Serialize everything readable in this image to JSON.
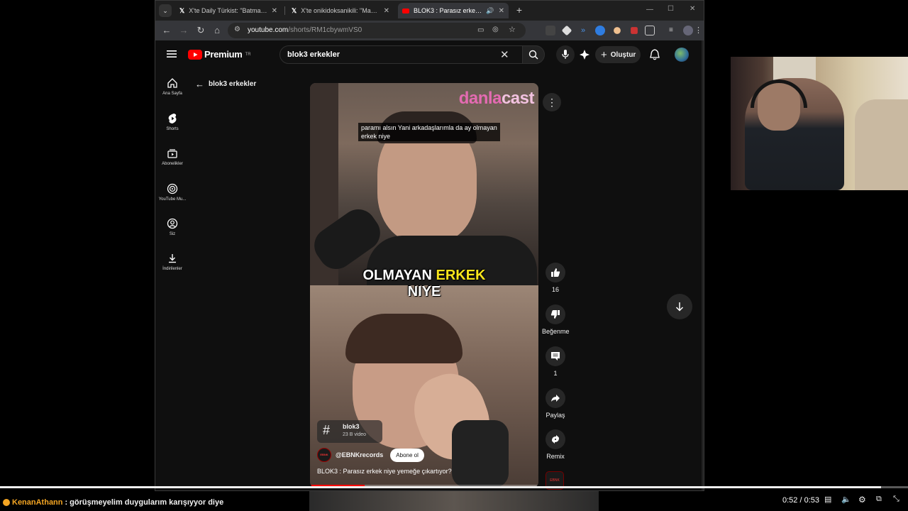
{
  "browser": {
    "tabs": [
      {
        "title": "X'te Daily Türkist: \"Batman'da y...",
        "icon": "x-logo-icon"
      },
      {
        "title": "X'te onikidoksanikili: \"Manifest...",
        "icon": "x-logo-icon"
      },
      {
        "title": "BLOK3 : Parasız erkek niye y...",
        "icon": "youtube-icon",
        "active": true
      }
    ],
    "url_host": "youtube.com",
    "url_path": "/shorts/RM1cbywmVS0"
  },
  "youtube": {
    "logo_text": "Premium",
    "logo_region": "TR",
    "search_value": "blok3 erkekler",
    "create_label": "Oluştur",
    "sidebar": [
      {
        "label": "Ana Sayfa",
        "icon": "home-icon"
      },
      {
        "label": "Shorts",
        "icon": "shorts-icon"
      },
      {
        "label": "Abonelikler",
        "icon": "subscriptions-icon"
      },
      {
        "label": "YouTube Mu...",
        "icon": "youtube-music-icon"
      },
      {
        "label": "Siz",
        "icon": "you-icon"
      },
      {
        "label": "İndirilenler",
        "icon": "downloads-icon"
      }
    ],
    "back_label": "blok3 erkekler",
    "video": {
      "brand_a": "danla",
      "brand_b": "cast",
      "caption": "paramı alsın Yani arkadaşlarımla da ay olmayan erkek niye",
      "big_caption_1": "OLMAYAN",
      "big_caption_2": "ERKEK",
      "big_caption_3": "NIYE",
      "hashtag": "blok3",
      "hashtag_count": "23 B video",
      "channel": "@EBNKrecords",
      "channel_avatar_text": "EBNK",
      "subscribe_label": "Abone ol",
      "title": "BLOK3 : Parasız erkek niye yemeğe çıkartıyor?",
      "progress": 0.24
    },
    "actions": {
      "like_count": "16",
      "dislike_label": "Beğenme",
      "comment_count": "1",
      "share_label": "Paylaş",
      "remix_label": "Remix",
      "sound_avatar_text": "EBNK"
    }
  },
  "stream": {
    "chat_user": "KenanAthann",
    "chat_sep": ":",
    "chat_message": "görüşmeyelim duygularım karışıyyor diye",
    "time": "0:52 / 0:53",
    "progress": 0.97
  }
}
